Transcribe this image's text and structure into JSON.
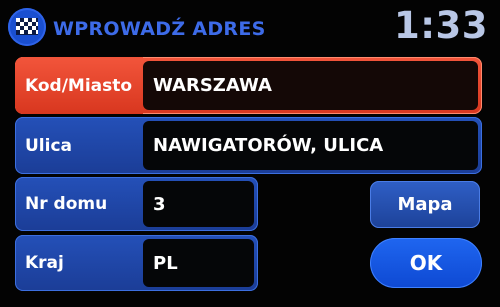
{
  "header": {
    "logo_icon": "checkered-flag-icon",
    "title": "WPROWADŹ ADRES",
    "clock": "1:33"
  },
  "fields": {
    "city": {
      "label": "Kod/Miasto",
      "value": "WARSZAWA"
    },
    "street": {
      "label": "Ulica",
      "value": "NAWIGATORÓW, ULICA"
    },
    "house_number": {
      "label": "Nr domu",
      "value": "3"
    },
    "country": {
      "label": "Kraj",
      "value": "PL"
    }
  },
  "buttons": {
    "map": "Mapa",
    "ok": "OK"
  },
  "colors": {
    "active_field": "#e2452b",
    "field": "#1f46a6",
    "accent_text": "#3d6be8",
    "ok_button": "#1457e4"
  }
}
